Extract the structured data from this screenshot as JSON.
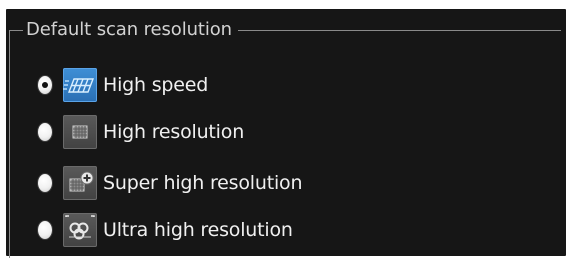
{
  "groupbox": {
    "title": "Default scan resolution"
  },
  "options": [
    {
      "label": "High speed",
      "icon": "scan-speed-icon",
      "selected": true
    },
    {
      "label": "High resolution",
      "icon": "grid-icon",
      "selected": false
    },
    {
      "label": "Super high resolution",
      "icon": "grid-plus-icon",
      "selected": false
    },
    {
      "label": "Ultra high resolution",
      "icon": "chain-links-icon",
      "selected": false
    }
  ],
  "colors": {
    "background": "#161616",
    "text": "#f0f0f0",
    "legend_text": "#d2d2d2",
    "selected_icon_bg": "#3f8fd6",
    "icon_bg": "#4c4c4c"
  }
}
